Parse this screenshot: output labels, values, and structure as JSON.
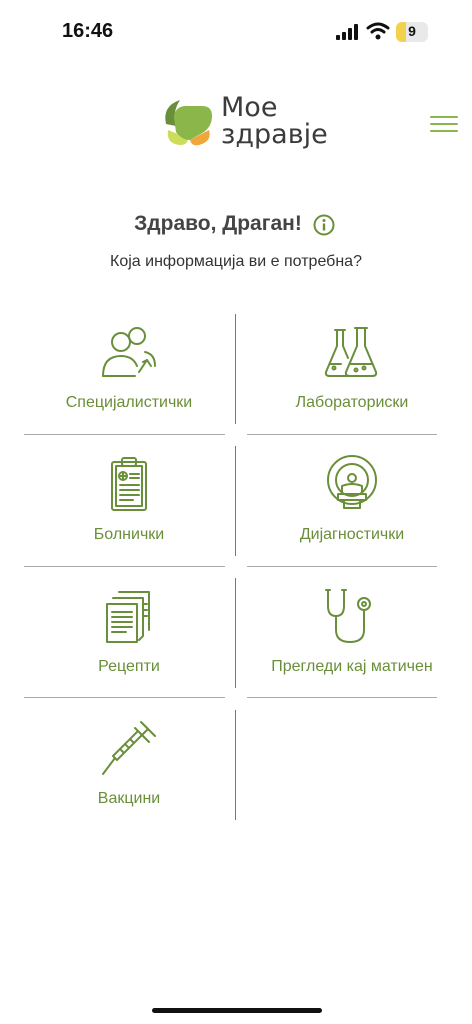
{
  "status_bar": {
    "time": "16:46",
    "battery_level": "9",
    "battery_fraction": 0.3
  },
  "header": {
    "logo_line1": "Мое",
    "logo_line2": "здравје",
    "menu_icon": "hamburger-icon",
    "brand_green": "#8bb64a",
    "brand_dark_green": "#6a8f3a",
    "brand_orange": "#f0a63a"
  },
  "greeting": {
    "title": "Здраво, Драган!",
    "info_icon": "info-icon",
    "subtitle": "Која информација ви е потребна?"
  },
  "categories": [
    {
      "label": "Специјалистички",
      "icon": "specialist-doctors-icon"
    },
    {
      "label": "Лабораториски",
      "icon": "lab-flasks-icon"
    },
    {
      "label": "Болнички",
      "icon": "clipboard-icon"
    },
    {
      "label": "Дијагностички",
      "icon": "ct-scanner-icon"
    },
    {
      "label": "Рецепти",
      "icon": "prescriptions-icon"
    },
    {
      "label": "Прегледи кај матичен",
      "icon": "stethoscope-icon"
    },
    {
      "label": "Вакцини",
      "icon": "syringe-icon"
    }
  ]
}
